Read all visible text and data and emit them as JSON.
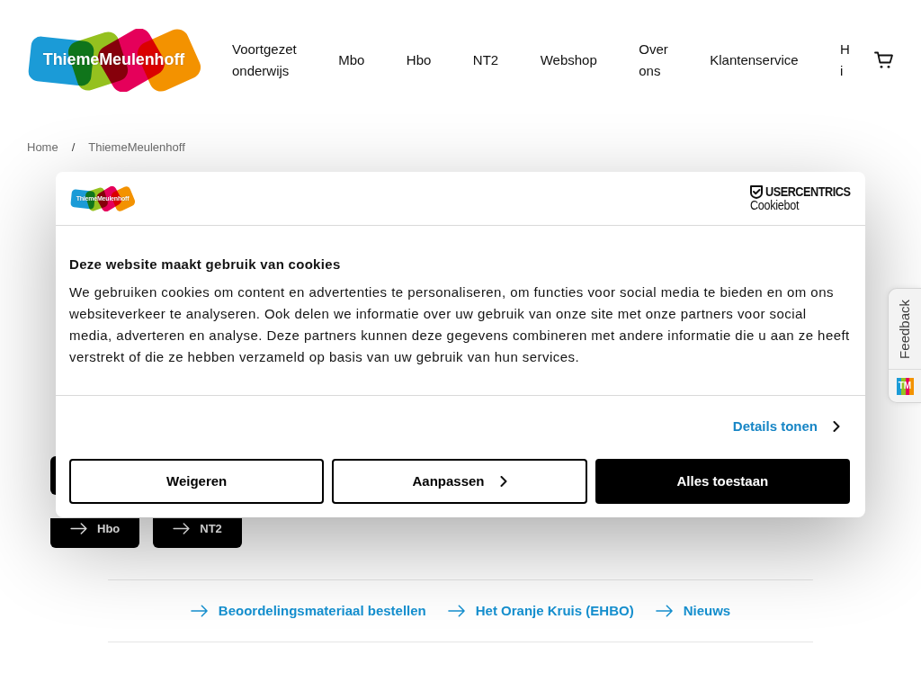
{
  "header": {
    "logo": "ThiemeMeulenhoff",
    "nav": [
      {
        "label": "Voortgezet onderwijs"
      },
      {
        "label": "Mbo"
      },
      {
        "label": "Hbo"
      },
      {
        "label": "NT2"
      },
      {
        "label": "Webshop"
      },
      {
        "label": "Over ons"
      },
      {
        "label": "Klantenservice"
      },
      {
        "label": "H i"
      }
    ]
  },
  "breadcrumb": {
    "items": [
      "Home",
      "ThiemeMeulenhoff"
    ],
    "separator": "/"
  },
  "section_buttons": [
    {
      "label": "Hbo"
    },
    {
      "label": "NT2"
    }
  ],
  "quick_links": [
    {
      "label": "Beoordelingsmateriaal bestellen"
    },
    {
      "label": "Het Oranje Kruis (EHBO)"
    },
    {
      "label": "Nieuws"
    }
  ],
  "cookie_dialog": {
    "logo": "ThiemeMeulenhoff",
    "provider": {
      "name": "USERCENTRICS",
      "product": "Cookiebot"
    },
    "title": "Deze website maakt gebruik van cookies",
    "text": "We gebruiken cookies om content en advertenties te personaliseren, om functies voor social media te bieden en om ons websiteverkeer te analyseren. Ook delen we informatie over uw gebruik van onze site met onze partners voor social media, adverteren en analyse. Deze partners kunnen deze gegevens combineren met andere informatie die u aan ze heeft verstrekt of die ze hebben verzameld op basis van uw gebruik van hun services.",
    "details_link": "Details tonen",
    "buttons": [
      {
        "label": "Weigeren",
        "kind": "outline",
        "chevron": false
      },
      {
        "label": "Aanpassen",
        "kind": "outline",
        "chevron": true
      },
      {
        "label": "Alles toestaan",
        "kind": "primary",
        "chevron": false
      }
    ]
  },
  "feedback_tab": {
    "label": "Feedback",
    "logo": "TM"
  }
}
